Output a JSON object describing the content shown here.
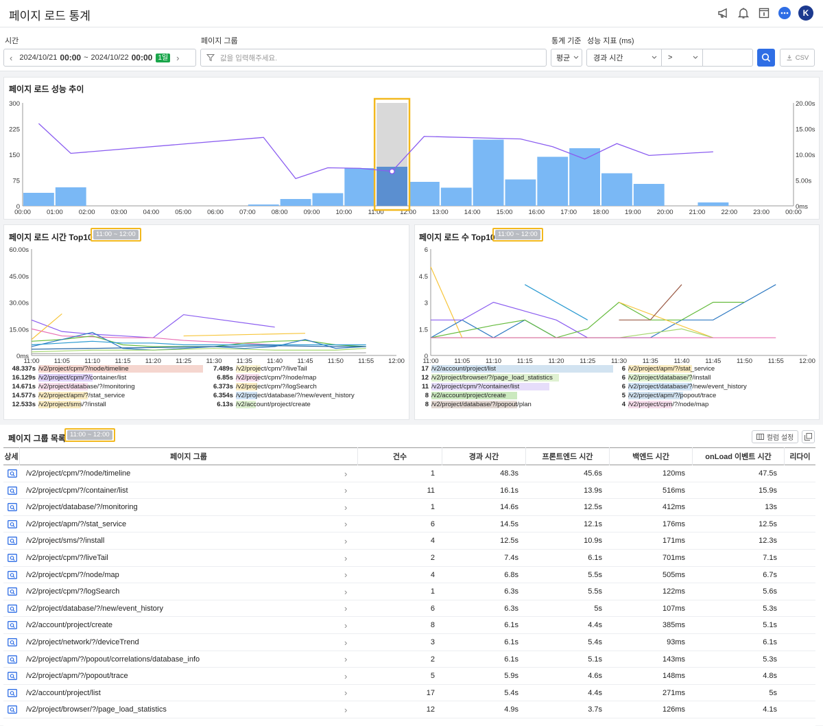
{
  "header": {
    "title": "페이지 로드 통계",
    "user_initial": "K"
  },
  "filters": {
    "time_label": "시간",
    "time_start_date": "2024/10/21",
    "time_start_hm": "00:00",
    "time_sep": "~",
    "time_end_date": "2024/10/22",
    "time_end_hm": "00:00",
    "time_badge": "1일",
    "group_label": "페이지 그룹",
    "group_placeholder": "값을 입력해주세요.",
    "stat_label": "통계 기준",
    "stat_value": "평균",
    "metric_label": "성능 지표 (ms)",
    "metric_value": "경과 시간",
    "op_value": ">",
    "threshold_value": "",
    "csv_label": "CSV"
  },
  "trend": {
    "title": "페이지 로드 성능 추이",
    "left_ticks": [
      "300",
      "225",
      "150",
      "75",
      "0"
    ],
    "right_ticks": [
      "20.00s",
      "15.00s",
      "10.00s",
      "5.00s",
      "0ms"
    ],
    "x_ticks": [
      "00:00",
      "01:00",
      "02:00",
      "03:00",
      "04:00",
      "05:00",
      "06:00",
      "07:00",
      "08:00",
      "09:00",
      "10:00",
      "11:00",
      "12:00",
      "13:00",
      "14:00",
      "15:00",
      "16:00",
      "17:00",
      "18:00",
      "19:00",
      "20:00",
      "21:00",
      "22:00",
      "23:00",
      "00:00"
    ],
    "chart_data": {
      "type": "bar",
      "ylim": [
        0,
        300
      ],
      "y2lim": [
        0,
        20
      ],
      "selected_hour": 11,
      "counts": [
        38,
        54,
        0,
        0,
        0,
        0,
        0,
        4,
        20,
        37,
        110,
        114,
        70,
        53,
        193,
        77,
        143,
        168,
        95,
        64,
        0,
        10,
        0,
        0
      ],
      "selected_total": 300,
      "line": [
        [
          0,
          16.0
        ],
        [
          1,
          10.2
        ],
        [
          7,
          13.3
        ],
        [
          8,
          5.3
        ],
        [
          9,
          7.4
        ],
        [
          10,
          7.3
        ],
        [
          11,
          6.7
        ],
        [
          12,
          13.5
        ],
        [
          15,
          13.0
        ],
        [
          16,
          11.5
        ],
        [
          17,
          9.1
        ],
        [
          18,
          12.1
        ],
        [
          19,
          9.8
        ],
        [
          21,
          10.5
        ]
      ]
    }
  },
  "time_top": {
    "title": "페이지 로드 시간 Top10",
    "range": "11:00 ~ 12:00",
    "y_ticks": [
      "60.00s",
      "45.00s",
      "30.00s",
      "15.00s",
      "0ms"
    ],
    "x_ticks": [
      "11:00",
      "11:05",
      "11:10",
      "11:15",
      "11:20",
      "11:25",
      "11:30",
      "11:35",
      "11:40",
      "11:45",
      "11:50",
      "11:55",
      "12:00"
    ],
    "chart_data": {
      "type": "line",
      "ylim": [
        0,
        60
      ],
      "series": [
        {
          "color": "#8a5cf0",
          "points": [
            [
              0,
              20
            ],
            [
              5,
              13.5
            ],
            [
              10,
              12
            ],
            [
              15,
              11
            ],
            [
              20,
              10
            ],
            [
              25,
              23
            ],
            [
              40,
              16
            ]
          ]
        },
        {
          "color": "#f7c53a",
          "points": [
            [
              0,
              9
            ],
            [
              5,
              23.5
            ]
          ]
        },
        {
          "color": "#e86fb4",
          "points": [
            [
              0,
              15
            ],
            [
              5,
              11
            ],
            [
              15,
              10
            ],
            [
              20,
              10
            ],
            [
              25,
              8.5
            ],
            [
              40,
              6
            ]
          ]
        },
        {
          "color": "#f7c53a",
          "points": [
            [
              25,
              11
            ],
            [
              45,
              12.5
            ]
          ]
        },
        {
          "color": "#65bb3d",
          "points": [
            [
              0,
              8
            ],
            [
              5,
              9
            ],
            [
              10,
              11
            ],
            [
              15,
              6
            ],
            [
              20,
              5
            ],
            [
              25,
              5
            ],
            [
              30,
              5
            ],
            [
              35,
              7
            ],
            [
              40,
              8
            ],
            [
              45,
              8.5
            ],
            [
              50,
              6
            ],
            [
              55,
              5
            ]
          ]
        },
        {
          "color": "#2e79c2",
          "points": [
            [
              0,
              5
            ],
            [
              10,
              13
            ],
            [
              15,
              4
            ],
            [
              20,
              3
            ],
            [
              25,
              4
            ],
            [
              30,
              5
            ],
            [
              35,
              4
            ],
            [
              40,
              5
            ],
            [
              45,
              9
            ],
            [
              50,
              4
            ],
            [
              55,
              5
            ]
          ]
        },
        {
          "color": "#2a9ad1",
          "points": [
            [
              0,
              6
            ],
            [
              5,
              7
            ],
            [
              10,
              8
            ],
            [
              15,
              7
            ],
            [
              20,
              7
            ],
            [
              25,
              6
            ],
            [
              30,
              6
            ],
            [
              35,
              6
            ],
            [
              40,
              6
            ],
            [
              45,
              6
            ],
            [
              50,
              6
            ],
            [
              55,
              6
            ]
          ]
        },
        {
          "color": "#1b5fa0",
          "points": [
            [
              0,
              3.5
            ],
            [
              10,
              4
            ],
            [
              20,
              4.5
            ],
            [
              30,
              5
            ],
            [
              40,
              5.5
            ],
            [
              50,
              5
            ],
            [
              55,
              5
            ]
          ]
        },
        {
          "color": "#a5d66e",
          "points": [
            [
              0,
              2
            ],
            [
              10,
              3
            ],
            [
              20,
              3
            ],
            [
              30,
              4
            ],
            [
              40,
              3
            ],
            [
              50,
              3
            ],
            [
              55,
              4
            ]
          ]
        },
        {
          "color": "#aaa",
          "points": [
            [
              0,
              1
            ],
            [
              55,
              1.5
            ]
          ]
        }
      ]
    },
    "legend_left": [
      {
        "value": "48.337s",
        "label": "/v2/project/cpm/?/node/timeline",
        "color": "#e8a494",
        "frac": 1.0
      },
      {
        "value": "16.129s",
        "label": "/v2/project/cpm/?/container/list",
        "color": "#b79cf0",
        "frac": 0.33
      },
      {
        "value": "14.671s",
        "label": "/v2/project/database/?/monitoring",
        "color": "#f0b9d6",
        "frac": 0.3
      },
      {
        "value": "14.577s",
        "label": "/v2/project/apm/?/stat_service",
        "color": "#f7d77c",
        "frac": 0.3
      },
      {
        "value": "12.533s",
        "label": "/v2/project/sms/?/install",
        "color": "#f7d77c",
        "frac": 0.26
      }
    ],
    "legend_right": [
      {
        "value": "7.489s",
        "label": "/v2/project/cpm/?/liveTail",
        "color": "#f7e69c",
        "frac": 0.15
      },
      {
        "value": "6.85s",
        "label": "/v2/project/cpm/?/node/map",
        "color": "#f0b9d6",
        "frac": 0.14
      },
      {
        "value": "6.373s",
        "label": "/v2/project/cpm/?/logSearch",
        "color": "#f7d77c",
        "frac": 0.13
      },
      {
        "value": "6.354s",
        "label": "/v2/project/database/?/new/event_history",
        "color": "#9cc5ee",
        "frac": 0.13
      },
      {
        "value": "6.13s",
        "label": "/v2/account/project/create",
        "color": "#b8e09a",
        "frac": 0.12
      }
    ]
  },
  "count_top": {
    "title": "페이지 로드 수 Top10",
    "range": "11:00 ~ 12:00",
    "y_ticks": [
      "6",
      "4.5",
      "3",
      "1.5",
      "0"
    ],
    "x_ticks": [
      "11:00",
      "11:05",
      "11:10",
      "11:15",
      "11:20",
      "11:25",
      "11:30",
      "11:35",
      "11:40",
      "11:45",
      "11:50",
      "11:55",
      "12:00"
    ],
    "chart_data": {
      "type": "line",
      "ylim": [
        0,
        6
      ],
      "series": [
        {
          "color": "#f7c53a",
          "points": [
            [
              0,
              5
            ],
            [
              5,
              1
            ]
          ]
        },
        {
          "color": "#2e79c2",
          "points": [
            [
              0,
              1
            ],
            [
              5,
              2
            ],
            [
              10,
              1
            ],
            [
              15,
              2
            ],
            [
              20,
              1
            ],
            [
              25,
              1
            ],
            [
              30,
              1
            ],
            [
              35,
              1
            ],
            [
              40,
              2
            ],
            [
              45,
              2
            ],
            [
              50,
              3
            ],
            [
              55,
              4
            ]
          ]
        },
        {
          "color": "#8a5cf0",
          "points": [
            [
              0,
              2
            ],
            [
              5,
              2
            ],
            [
              10,
              3
            ],
            [
              15,
              2.5
            ],
            [
              20,
              2
            ],
            [
              25,
              1
            ]
          ]
        },
        {
          "color": "#2a9ad1",
          "points": [
            [
              15,
              4
            ],
            [
              25,
              2
            ]
          ]
        },
        {
          "color": "#65bb3d",
          "points": [
            [
              0,
              1
            ],
            [
              10,
              1.7
            ],
            [
              15,
              2
            ],
            [
              20,
              1
            ],
            [
              25,
              1.5
            ],
            [
              30,
              3
            ],
            [
              35,
              2
            ],
            [
              40,
              2
            ],
            [
              45,
              3
            ],
            [
              50,
              3
            ]
          ]
        },
        {
          "color": "#f7c53a",
          "points": [
            [
              30,
              3
            ],
            [
              45,
              1
            ]
          ]
        },
        {
          "color": "#9b5a45",
          "points": [
            [
              30,
              2
            ],
            [
              35,
              2
            ],
            [
              40,
              4
            ]
          ]
        },
        {
          "color": "#a5d66e",
          "points": [
            [
              0,
              1
            ],
            [
              30,
              1
            ],
            [
              40,
              1.5
            ],
            [
              45,
              1
            ]
          ]
        },
        {
          "color": "#e86fb4",
          "points": [
            [
              0,
              1
            ],
            [
              55,
              1
            ]
          ]
        }
      ]
    },
    "legend_left": [
      {
        "value": "17",
        "label": "/v2/account/project/list",
        "color": "#9cc0e0",
        "frac": 1.0
      },
      {
        "value": "12",
        "label": "/v2/project/browser/?/page_load_statistics",
        "color": "#b8e09a",
        "frac": 0.7
      },
      {
        "value": "11",
        "label": "/v2/project/cpm/?/container/list",
        "color": "#c8b3f5",
        "frac": 0.65
      },
      {
        "value": "8",
        "label": "/v2/account/project/create",
        "color": "#8ccf70",
        "frac": 0.47
      },
      {
        "value": "8",
        "label": "/v2/project/database/?/popout/plan",
        "color": "#c0a89c",
        "frac": 0.47
      }
    ],
    "legend_right": [
      {
        "value": "6",
        "label": "/v2/project/apm/?/stat_service",
        "color": "#f7d77c",
        "frac": 0.35
      },
      {
        "value": "6",
        "label": "/v2/project/database/?/install",
        "color": "#b8e09a",
        "frac": 0.35
      },
      {
        "value": "6",
        "label": "/v2/project/database/?/new/event_history",
        "color": "#9cc5ee",
        "frac": 0.35
      },
      {
        "value": "5",
        "label": "/v2/project/apm/?/popout/trace",
        "color": "#9cc0e0",
        "frac": 0.3
      },
      {
        "value": "4",
        "label": "/v2/project/cpm/?/node/map",
        "color": "#f0b9d6",
        "frac": 0.24
      }
    ]
  },
  "group_list": {
    "title": "페이지 그룹 목록",
    "range": "11:00 ~ 12:00",
    "column_settings": "컬럼 설정",
    "columns": [
      "상세",
      "페이지 그룹",
      "건수",
      "경과 시간",
      "프론트엔드 시간",
      "백엔드 시간",
      "onLoad 이벤트 시간",
      "리다이"
    ],
    "rows": [
      [
        "/v2/project/cpm/?/node/timeline",
        "1",
        "48.3s",
        "45.6s",
        "120ms",
        "47.5s"
      ],
      [
        "/v2/project/cpm/?/container/list",
        "11",
        "16.1s",
        "13.9s",
        "516ms",
        "15.9s"
      ],
      [
        "/v2/project/database/?/monitoring",
        "1",
        "14.6s",
        "12.5s",
        "412ms",
        "13s"
      ],
      [
        "/v2/project/apm/?/stat_service",
        "6",
        "14.5s",
        "12.1s",
        "176ms",
        "12.5s"
      ],
      [
        "/v2/project/sms/?/install",
        "4",
        "12.5s",
        "10.9s",
        "171ms",
        "12.3s"
      ],
      [
        "/v2/project/cpm/?/liveTail",
        "2",
        "7.4s",
        "6.1s",
        "701ms",
        "7.1s"
      ],
      [
        "/v2/project/cpm/?/node/map",
        "4",
        "6.8s",
        "5.5s",
        "505ms",
        "6.7s"
      ],
      [
        "/v2/project/cpm/?/logSearch",
        "1",
        "6.3s",
        "5.5s",
        "122ms",
        "5.6s"
      ],
      [
        "/v2/project/database/?/new/event_history",
        "6",
        "6.3s",
        "5s",
        "107ms",
        "5.3s"
      ],
      [
        "/v2/account/project/create",
        "8",
        "6.1s",
        "4.4s",
        "385ms",
        "5.1s"
      ],
      [
        "/v2/project/network/?/deviceTrend",
        "3",
        "6.1s",
        "5.4s",
        "93ms",
        "6.1s"
      ],
      [
        "/v2/project/apm/?/popout/correlations/database_info",
        "2",
        "6.1s",
        "5.1s",
        "143ms",
        "5.3s"
      ],
      [
        "/v2/project/apm/?/popout/trace",
        "5",
        "5.9s",
        "4.6s",
        "148ms",
        "4.8s"
      ],
      [
        "/v2/account/project/list",
        "17",
        "5.4s",
        "4.4s",
        "271ms",
        "5s"
      ],
      [
        "/v2/project/browser/?/page_load_statistics",
        "12",
        "4.9s",
        "3.7s",
        "126ms",
        "4.1s"
      ]
    ]
  }
}
